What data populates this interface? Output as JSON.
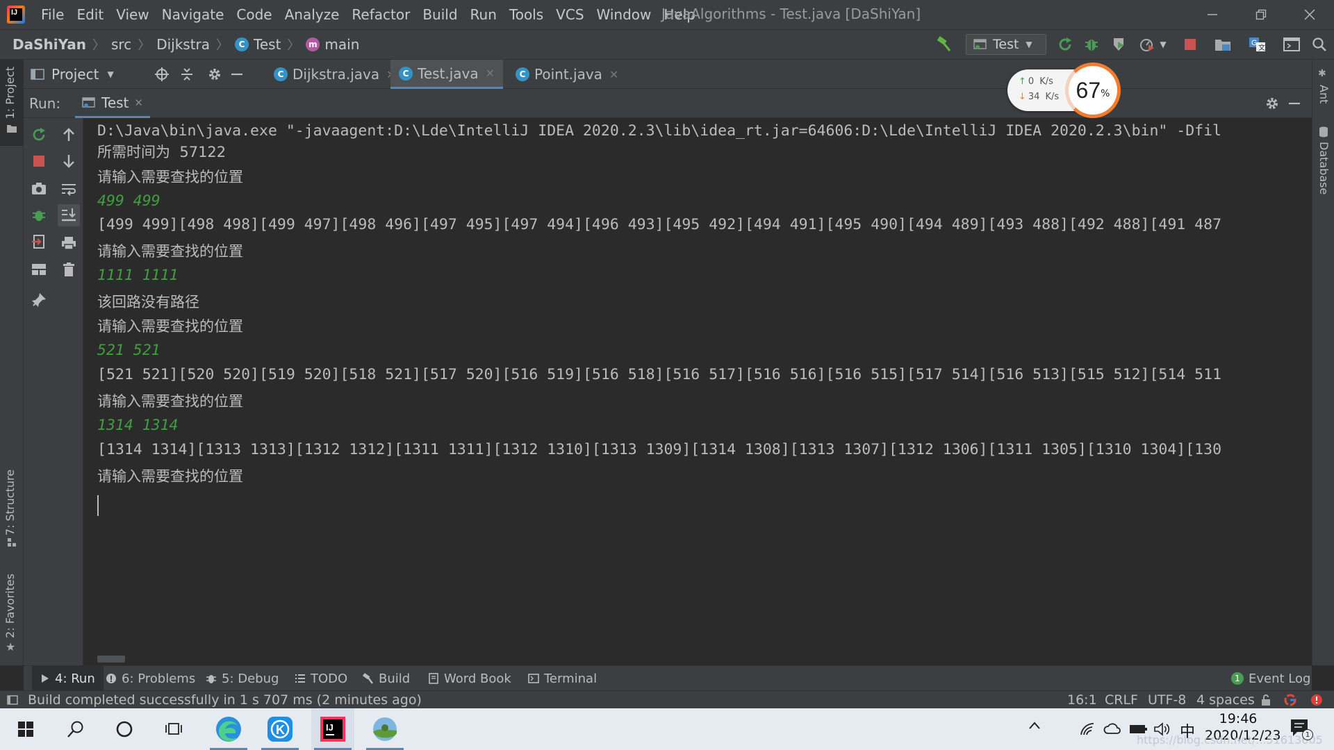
{
  "window": {
    "title": "JavaAlgorithms - Test.java [DaShiYan]",
    "logo_text": "IJ"
  },
  "menu": [
    "File",
    "Edit",
    "View",
    "Navigate",
    "Code",
    "Analyze",
    "Refactor",
    "Build",
    "Run",
    "Tools",
    "VCS",
    "Window",
    "Help"
  ],
  "breadcrumbs": {
    "project": "DaShiYan",
    "folder": "src",
    "package": "Dijkstra",
    "class": "Test",
    "method": "main",
    "class_icon_letter": "C",
    "method_icon_letter": "m"
  },
  "run_config": "Test",
  "left_stripe": {
    "project_tab": "1: Project",
    "structure_tab": "7: Structure",
    "favorites_tab": "2: Favorites"
  },
  "right_stripe": {
    "ant_tab": "Ant",
    "database_tab": "Database"
  },
  "project_panel": {
    "label": "Project"
  },
  "editor_tabs": [
    {
      "label": "Dijkstra.java",
      "icon": "C",
      "active": false
    },
    {
      "label": "Test.java",
      "icon": "C",
      "active": true
    },
    {
      "label": "Point.java",
      "icon": "C",
      "active": false
    }
  ],
  "run_panel": {
    "label": "Run:",
    "tab_label": "Test"
  },
  "console_lines": [
    {
      "text": "D:\\Java\\bin\\java.exe \"-javaagent:D:\\Lde\\IntelliJ IDEA 2020.2.3\\lib\\idea_rt.jar=64606:D:\\Lde\\IntelliJ IDEA 2020.2.3\\bin\" -Dfil",
      "kind": "out"
    },
    {
      "text": "所需时间为  57122",
      "kind": "zh"
    },
    {
      "text": "请输入需要查找的位置",
      "kind": "zh"
    },
    {
      "text": "499 499",
      "kind": "in"
    },
    {
      "text": "[499 499][498 498][499 497][498 496][497 495][497 494][496 493][495 492][494 491][495 490][494 489][493 488][492 488][491 487",
      "kind": "out"
    },
    {
      "text": "请输入需要查找的位置",
      "kind": "zh"
    },
    {
      "text": "1111 1111",
      "kind": "in"
    },
    {
      "text": "该回路没有路径",
      "kind": "zh"
    },
    {
      "text": "请输入需要查找的位置",
      "kind": "zh"
    },
    {
      "text": "521 521",
      "kind": "in"
    },
    {
      "text": "[521 521][520 520][519 520][518 521][517 520][516 519][516 518][516 517][516 516][516 515][517 514][516 513][515 512][514 511",
      "kind": "out"
    },
    {
      "text": "请输入需要查找的位置",
      "kind": "zh"
    },
    {
      "text": "1314 1314",
      "kind": "in"
    },
    {
      "text": "[1314 1314][1313 1313][1312 1312][1311 1311][1312 1310][1313 1309][1314 1308][1313 1307][1312 1306][1311 1305][1310 1304][130",
      "kind": "out"
    },
    {
      "text": "请输入需要查找的位置",
      "kind": "zh"
    }
  ],
  "net_widget": {
    "up": "0",
    "down": "34",
    "unit": "K/s",
    "percent": "67",
    "percent_sign": "%"
  },
  "bottom_tabs": [
    {
      "label": "4: Run"
    },
    {
      "label": "6: Problems"
    },
    {
      "label": "5: Debug"
    },
    {
      "label": "TODO"
    },
    {
      "label": "Build"
    },
    {
      "label": "Word Book"
    },
    {
      "label": "Terminal"
    }
  ],
  "event_log": {
    "label": "Event Log",
    "count": "1"
  },
  "status": {
    "message": "Build completed successfully in 1 s 707 ms (2 minutes ago)",
    "position": "16:1",
    "line_sep": "CRLF",
    "encoding": "UTF-8",
    "indent": "4 spaces"
  },
  "taskbar": {
    "time": "19:46",
    "date": "2020/12/23",
    "ime": "中",
    "watermark": "https://blog.csdn.net/...51613605",
    "notif_count": "1"
  },
  "colors": {
    "accent": "#4a88c7",
    "stop_red": "#c75450",
    "run_green": "#499c54",
    "input_green": "#3f9f3f"
  }
}
